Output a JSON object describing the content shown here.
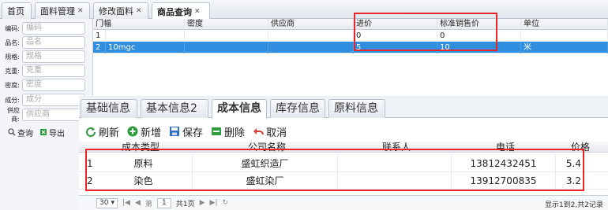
{
  "tabs": [
    {
      "label": "首页",
      "closable": false
    },
    {
      "label": "面料管理",
      "closable": true
    },
    {
      "label": "修改面料",
      "closable": true
    },
    {
      "label": "商品查询",
      "closable": true,
      "active": true
    }
  ],
  "filters": [
    {
      "label": "编码:",
      "placeholder": "编码"
    },
    {
      "label": "品名:",
      "placeholder": "品名"
    },
    {
      "label": "规格:",
      "placeholder": "规格"
    },
    {
      "label": "克重:",
      "placeholder": "克重"
    },
    {
      "label": "密度:",
      "placeholder": "密度"
    },
    {
      "label": "成分:",
      "placeholder": "成分"
    },
    {
      "label": "供应商:",
      "placeholder": "供应商"
    }
  ],
  "filter_buttons": {
    "query": "查询",
    "export": "导出"
  },
  "grid1": {
    "columns": [
      "门幅",
      "密度",
      "供应商",
      "进价",
      "标准销售价",
      "单位"
    ],
    "rows": [
      {
        "num": "1",
        "width": "",
        "density": "",
        "supplier": "",
        "cost": "0",
        "price": "0",
        "unit": ""
      },
      {
        "num": "2",
        "width": "10mgc",
        "density": "",
        "supplier": "",
        "cost": "5",
        "price": "10",
        "unit": "米"
      }
    ]
  },
  "detail_tabs": [
    "基础信息",
    "基本信息2",
    "成本信息",
    "库存信息",
    "原料信息"
  ],
  "toolbar": {
    "refresh": "刷新",
    "add": "新增",
    "save": "保存",
    "delete": "删除",
    "cancel": "取消"
  },
  "grid2": {
    "columns": [
      "成本类型",
      "公司名称",
      "联系人",
      "电话",
      "价格"
    ],
    "rows": [
      {
        "num": "1",
        "type": "原料",
        "company": "盛虹织造厂",
        "contact": "",
        "phone": "13812432451",
        "price": "5.4"
      },
      {
        "num": "2",
        "type": "染色",
        "company": "盛虹染厂",
        "contact": "",
        "phone": "13912700835",
        "price": "3.2"
      }
    ]
  },
  "pager": {
    "page_size": "30",
    "page": "1",
    "total_pages": "共1页",
    "info": "显示1到2,共2记录"
  },
  "colors": {
    "selected_row": "#2f8ee0",
    "highlight_border": "#e8262a"
  }
}
